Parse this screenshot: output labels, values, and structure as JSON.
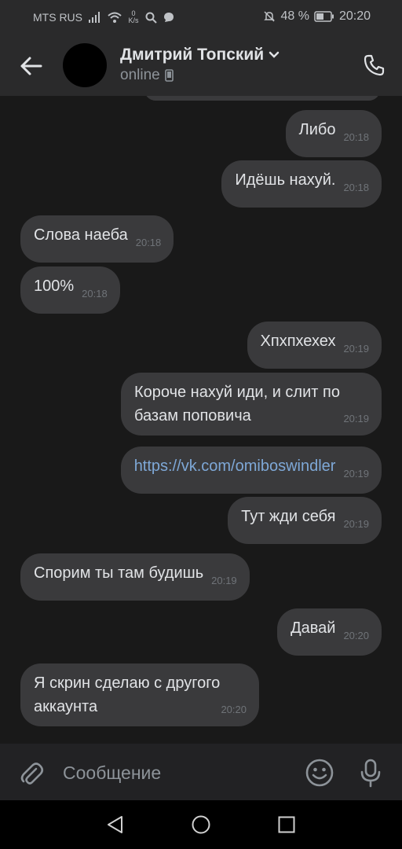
{
  "status_bar": {
    "carrier": "MTS RUS",
    "speed_value": "0",
    "speed_unit": "K/s",
    "battery": "48 %",
    "time": "20:20"
  },
  "header": {
    "name": "Дмитрий Топский",
    "status": "online"
  },
  "messages": [
    {
      "text": "Либо",
      "time": "20:18",
      "side": "out"
    },
    {
      "text": "Идёшь нахуй.",
      "time": "20:18",
      "side": "out"
    },
    {
      "text": "Слова наеба",
      "time": "20:18",
      "side": "in"
    },
    {
      "text": "100%",
      "time": "20:18",
      "side": "in"
    },
    {
      "text": "Хпхпхехех",
      "time": "20:19",
      "side": "out"
    },
    {
      "text": "Короче нахуй иди, и слит по базам поповича",
      "time": "20:19",
      "side": "out"
    },
    {
      "text": "https://vk.com/omiboswindler",
      "time": "20:19",
      "side": "out"
    },
    {
      "text": "Тут жди себя",
      "time": "20:19",
      "side": "out"
    },
    {
      "text": "Спорим ты там будишь",
      "time": "20:19",
      "side": "in"
    },
    {
      "text": "Давай",
      "time": "20:20",
      "side": "out"
    },
    {
      "text": "Я скрин сделаю с другого аккаунта",
      "time": "20:20",
      "side": "in"
    }
  ],
  "composer": {
    "placeholder": "Сообщение"
  },
  "icons": {
    "back": "arrow-left-icon",
    "call": "phone-icon",
    "attach": "paperclip-icon",
    "emoji": "smiley-icon",
    "mic": "microphone-icon"
  },
  "colors": {
    "background": "#191919",
    "bubble": "#3a3a3c",
    "header": "#2a2a2b",
    "link": "#7ea8d7"
  }
}
